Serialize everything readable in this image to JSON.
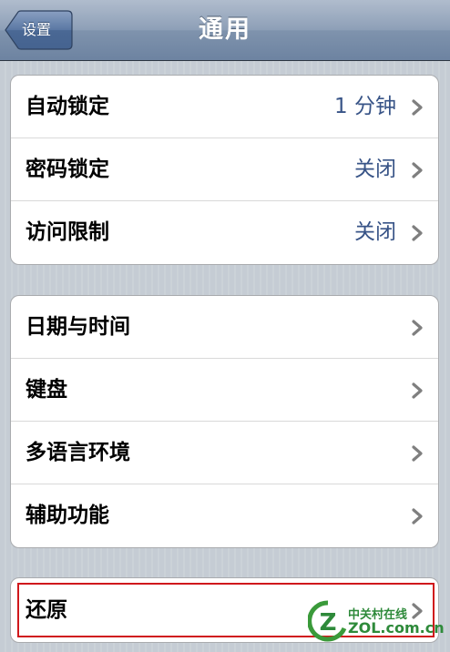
{
  "nav": {
    "title": "通用",
    "back_label": "设置"
  },
  "groups": [
    {
      "rows": [
        {
          "label": "自动锁定",
          "value": "1 分钟"
        },
        {
          "label": "密码锁定",
          "value": "关闭"
        },
        {
          "label": "访问限制",
          "value": "关闭"
        }
      ]
    },
    {
      "rows": [
        {
          "label": "日期与时间"
        },
        {
          "label": "键盘"
        },
        {
          "label": "多语言环境"
        },
        {
          "label": "辅助功能"
        }
      ]
    },
    {
      "rows": [
        {
          "label": "还原"
        }
      ]
    }
  ],
  "watermark": {
    "cn": "中关村在线",
    "en": "ZOL.com.cn",
    "logo": "Z"
  },
  "colors": {
    "nav_bar": "#6d83a1",
    "value_text": "#385487",
    "highlight": "#d0181c"
  }
}
